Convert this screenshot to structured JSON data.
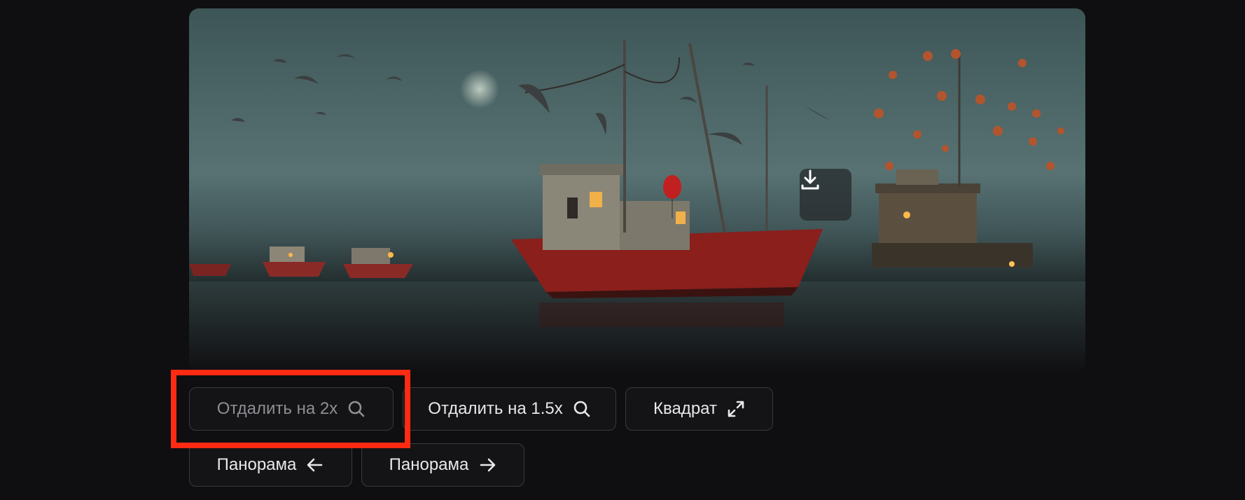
{
  "image": {
    "description_icon": "download-icon"
  },
  "actions": {
    "zoom_out_2x": {
      "label": "Отдалить на 2x",
      "icon": "search-icon",
      "state": "disabled"
    },
    "zoom_out_1_5x": {
      "label": "Отдалить на 1.5x",
      "icon": "search-icon"
    },
    "square": {
      "label": "Квадрат",
      "icon": "expand-icon"
    },
    "pan_left": {
      "label": "Панорама",
      "icon": "arrow-left-icon"
    },
    "pan_right": {
      "label": "Панорама",
      "icon": "arrow-right-icon"
    }
  },
  "colors": {
    "background": "#0f0f11",
    "button_border": "#3a3a3e",
    "highlight": "#ff2a12"
  }
}
